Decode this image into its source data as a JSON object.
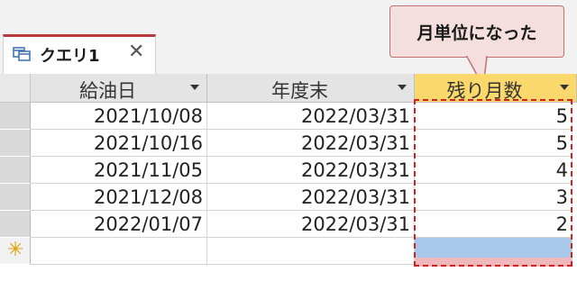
{
  "tab": {
    "label": "クエリ1",
    "close_glyph": "✕",
    "icon": "query-table-icon"
  },
  "callout": {
    "text": "月単位になった"
  },
  "columns": [
    {
      "label": "給油日"
    },
    {
      "label": "年度末"
    },
    {
      "label": "残り月数"
    }
  ],
  "rows": [
    {
      "date": "2021/10/08",
      "fy_end": "2022/03/31",
      "months": "5"
    },
    {
      "date": "2021/10/16",
      "fy_end": "2022/03/31",
      "months": "5"
    },
    {
      "date": "2021/11/05",
      "fy_end": "2022/03/31",
      "months": "4"
    },
    {
      "date": "2021/12/08",
      "fy_end": "2022/03/31",
      "months": "3"
    },
    {
      "date": "2022/01/07",
      "fy_end": "2022/03/31",
      "months": "2"
    }
  ],
  "new_row_marker": "✳",
  "colors": {
    "tab_accent": "#b83a3a",
    "active_header": "#fbd86b",
    "highlight_box": "#d61e1e",
    "callout_fill": "#f4dede"
  }
}
